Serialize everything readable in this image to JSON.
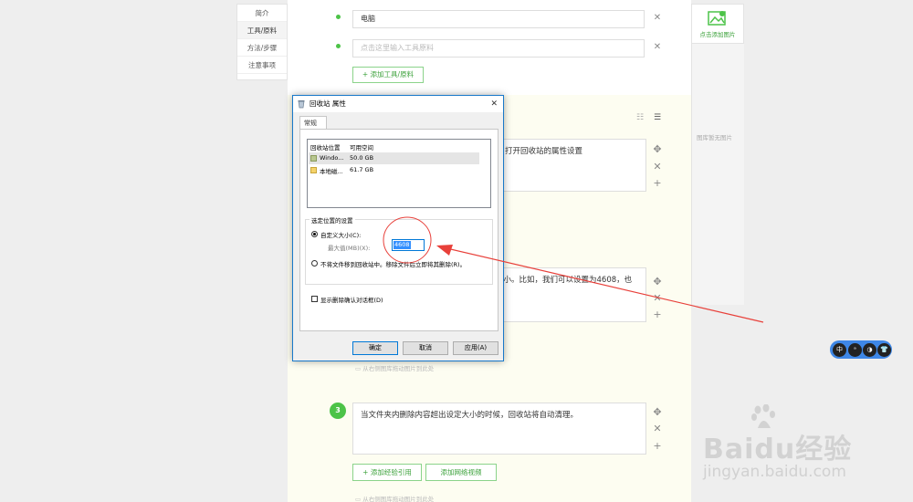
{
  "left_nav": {
    "items": [
      "简介",
      "工具/原料",
      "方法/步骤",
      "注意事项"
    ],
    "active_index": 1
  },
  "tools": {
    "items": [
      {
        "value": "电脑",
        "placeholder": ""
      },
      {
        "value": "",
        "placeholder": "点击这里输入工具原料"
      }
    ],
    "add_tool_label": "+ 添加工具/原料"
  },
  "steps": {
    "step1_text": "打开回收站的属性设置",
    "step2_text": "大小。比如，我们可以设置为4608，也",
    "step3_number": "3",
    "step3_text": "当文件夹内删除内容超出设定大小的时候，回收站将自动清理。",
    "drag_hint": "从右侧图库拖动图片到此处",
    "add_experience_label": "+ 添加经验引用",
    "add_video_label": "添加网络视频"
  },
  "right_bar": {
    "add_image_label": "点击添加图片",
    "empty_gallery_text": "图库暂无图片"
  },
  "dialog": {
    "title": "回收站 属性",
    "tab_general": "常规",
    "list_header": [
      "回收站位置",
      "可用空间"
    ],
    "list_rows": [
      {
        "location": "Windo...",
        "space": "50.0 GB"
      },
      {
        "location": "本地磁...",
        "space": "61.7 GB"
      }
    ],
    "group_label": "选定位置的设置",
    "custom_size_label": "自定义大小(C):",
    "max_size_label": "最大值(MB)(X):",
    "max_size_value": "4608",
    "no_recycle_label": "不将文件移到回收站中。移除文件后立即将其删除(R)。",
    "show_confirm_label": "显示删除确认对话框(D)",
    "ok_label": "确定",
    "cancel_label": "取消",
    "apply_label": "应用(A)",
    "close_glyph": "✕"
  },
  "float_toolbar": {
    "buttons": [
      "中",
      "ᵃ",
      "◑",
      "👕"
    ]
  },
  "watermark": {
    "brand": "Baidu经验",
    "url": "jingyan.baidu.com"
  },
  "colors": {
    "accent_green": "#4cc348",
    "dialog_border": "#1979ca",
    "annotation_red": "#e8403a",
    "float_bar_blue": "#3e87e6"
  }
}
